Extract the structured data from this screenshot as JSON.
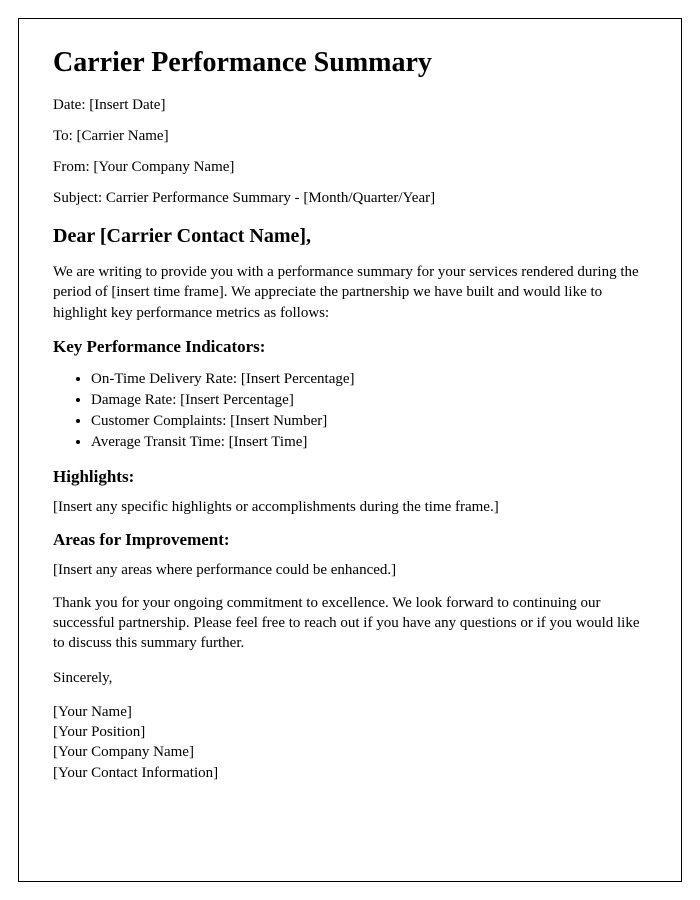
{
  "title": "Carrier Performance Summary",
  "meta": {
    "date": "Date: [Insert Date]",
    "to": "To: [Carrier Name]",
    "from": "From: [Your Company Name]",
    "subject": "Subject: Carrier Performance Summary - [Month/Quarter/Year]"
  },
  "salutation": "Dear [Carrier Contact Name],",
  "intro": "We are writing to provide you with a performance summary for your services rendered during the period of [insert time frame]. We appreciate the partnership we have built and would like to highlight key performance metrics as follows:",
  "sections": {
    "kpi": {
      "heading": "Key Performance Indicators:",
      "items": [
        "On-Time Delivery Rate: [Insert Percentage]",
        "Damage Rate: [Insert Percentage]",
        "Customer Complaints: [Insert Number]",
        "Average Transit Time: [Insert Time]"
      ]
    },
    "highlights": {
      "heading": "Highlights:",
      "body": "[Insert any specific highlights or accomplishments during the time frame.]"
    },
    "improvement": {
      "heading": "Areas for Improvement:",
      "body": "[Insert any areas where performance could be enhanced.]"
    }
  },
  "closing": "Thank you for your ongoing commitment to excellence. We look forward to continuing our successful partnership. Please feel free to reach out if you have any questions or if you would like to discuss this summary further.",
  "signoff": "Sincerely,",
  "signature": {
    "name": "[Your Name]",
    "position": "[Your Position]",
    "company": "[Your Company Name]",
    "contact": "[Your Contact Information]"
  }
}
